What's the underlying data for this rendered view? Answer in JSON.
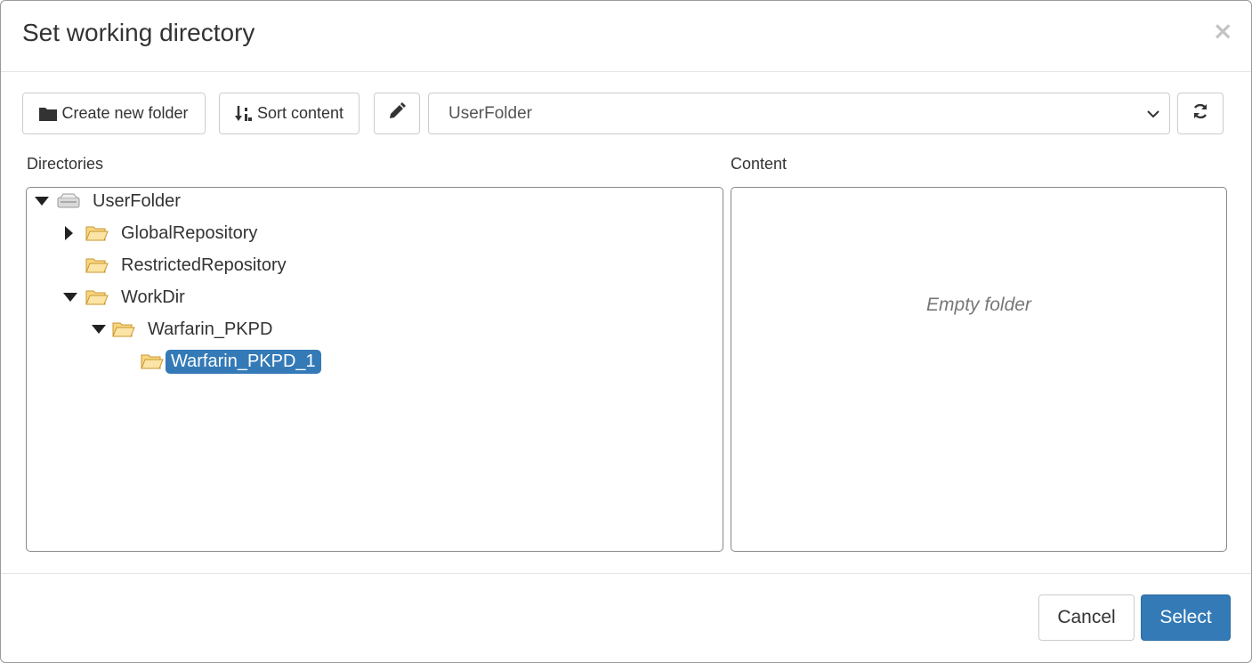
{
  "dialog": {
    "title": "Set working directory",
    "close_glyph": "×"
  },
  "toolbar": {
    "create_folder_label": "Create new folder",
    "create_folder_icon": "folder-icon",
    "sort_label": "Sort content",
    "sort_icon": "sort-icon",
    "edit_icon": "pencil-icon",
    "location_selected": "UserFolder",
    "refresh_icon": "refresh-icon"
  },
  "directories": {
    "label": "Directories",
    "tree": [
      {
        "label": "UserFolder",
        "icon": "drive-icon",
        "expanded": true,
        "level": 0
      },
      {
        "label": "GlobalRepository",
        "icon": "folder-open-icon",
        "expanded": false,
        "level": 1
      },
      {
        "label": "RestrictedRepository",
        "icon": "folder-open-icon",
        "level": 1
      },
      {
        "label": "WorkDir",
        "icon": "folder-open-icon",
        "expanded": true,
        "level": 1
      },
      {
        "label": "Warfarin_PKPD",
        "icon": "folder-open-icon",
        "expanded": true,
        "level": 2
      },
      {
        "label": "Warfarin_PKPD_1",
        "icon": "folder-open-icon",
        "selected": true,
        "level": 3
      }
    ]
  },
  "content": {
    "label": "Content",
    "empty_text": "Empty folder"
  },
  "footer": {
    "cancel_label": "Cancel",
    "select_label": "Select"
  },
  "colors": {
    "primary": "#337ab7",
    "folder": "#f0c05a"
  }
}
